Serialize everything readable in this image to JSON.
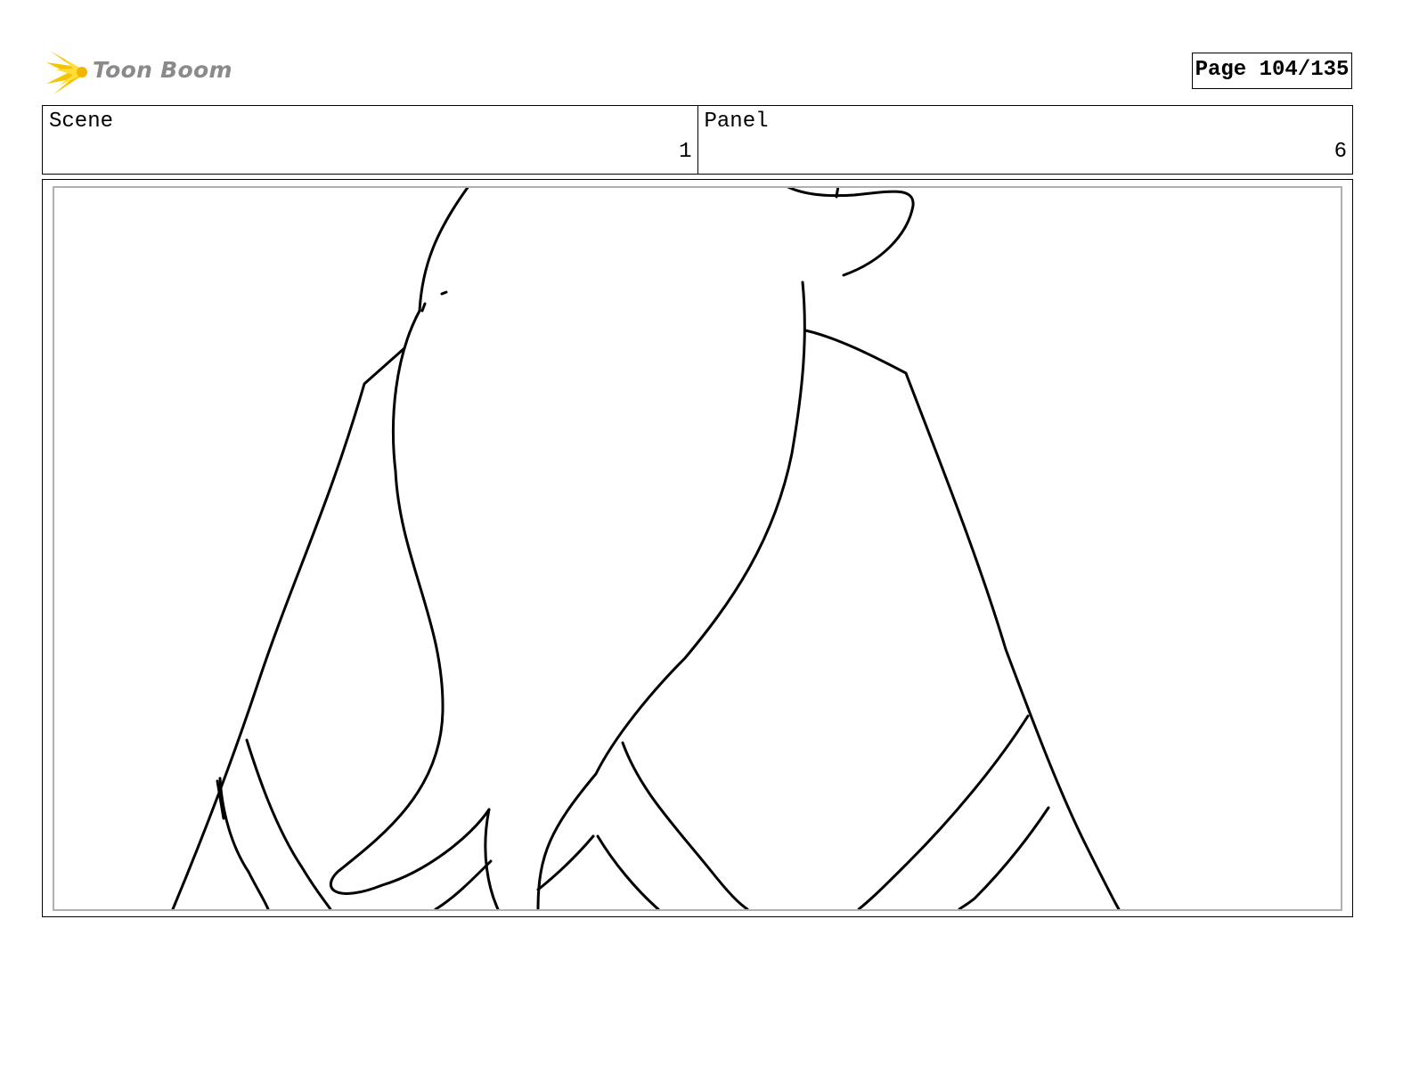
{
  "header": {
    "logo_text": "Toon Boom",
    "page_label": "Page 104/135"
  },
  "info": {
    "scene_label": "Scene",
    "scene_value": "1",
    "panel_label": "Panel",
    "panel_value": "6"
  },
  "colors": {
    "logo_yellow": "#f5c400",
    "logo_text_gray": "#8a8a8a",
    "inner_border_gray": "#b0b0b0"
  }
}
